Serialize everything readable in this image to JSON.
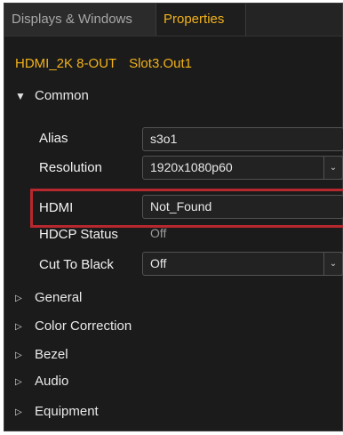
{
  "tabs": [
    {
      "label": "Displays & Windows"
    },
    {
      "label": "Properties"
    }
  ],
  "device": {
    "model": "HDMI_2K 8-OUT",
    "slot": "Slot3.Out1"
  },
  "common": {
    "label": "Common",
    "rows": {
      "alias": {
        "label": "Alias",
        "value": "s3o1"
      },
      "resolution": {
        "label": "Resolution",
        "value": "1920x1080p60"
      },
      "hdmi": {
        "label": "HDMI",
        "value": "Not_Found"
      },
      "hdcp": {
        "label": "HDCP Status",
        "value": "Off"
      },
      "cut_to_black": {
        "label": "Cut To Black",
        "value": "Off"
      }
    }
  },
  "sections": [
    {
      "label": "General"
    },
    {
      "label": "Color Correction"
    },
    {
      "label": "Bezel"
    },
    {
      "label": "Audio"
    },
    {
      "label": "Equipment"
    }
  ],
  "colors": {
    "accent": "#f2b21b",
    "highlight_border": "#b7282e",
    "background": "#1b1b1b"
  }
}
